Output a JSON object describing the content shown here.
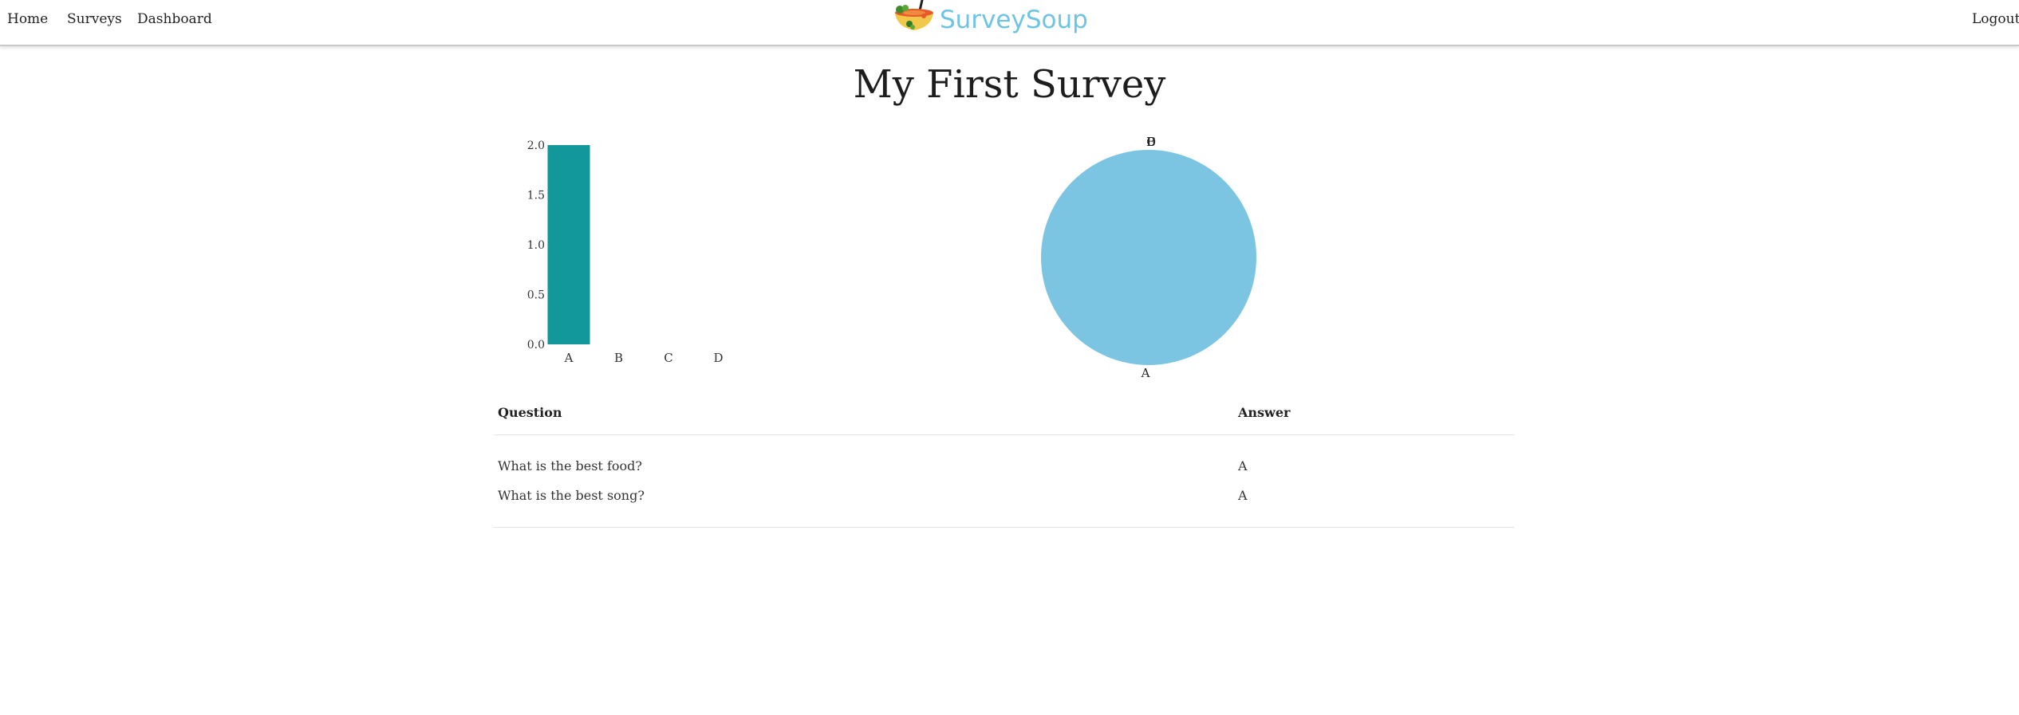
{
  "nav": {
    "links": [
      "Home",
      "Surveys",
      "Dashboard"
    ],
    "brand": "SurveySoup",
    "logout": "Logout"
  },
  "title": "My First Survey",
  "colors": {
    "bar": "#12979b",
    "pie": "#7bc5e3",
    "brand": "#6ec3e6"
  },
  "chart_data": [
    {
      "type": "bar",
      "categories": [
        "A",
        "B",
        "C",
        "D"
      ],
      "values": [
        2,
        0,
        0,
        0
      ],
      "ylim": [
        0,
        2
      ],
      "yticks": [
        "0.0",
        "0.5",
        "1.0",
        "1.5",
        "2.0"
      ],
      "grid": false,
      "legend": "none"
    },
    {
      "type": "pie",
      "categories": [
        "A",
        "B",
        "C",
        "D"
      ],
      "values": [
        2,
        0,
        0,
        0
      ],
      "legend": "none"
    }
  ],
  "table": {
    "headers": [
      "Question",
      "Answer"
    ],
    "rows": [
      [
        "What is the best food?",
        "A"
      ],
      [
        "What is the best song?",
        "A"
      ]
    ]
  }
}
